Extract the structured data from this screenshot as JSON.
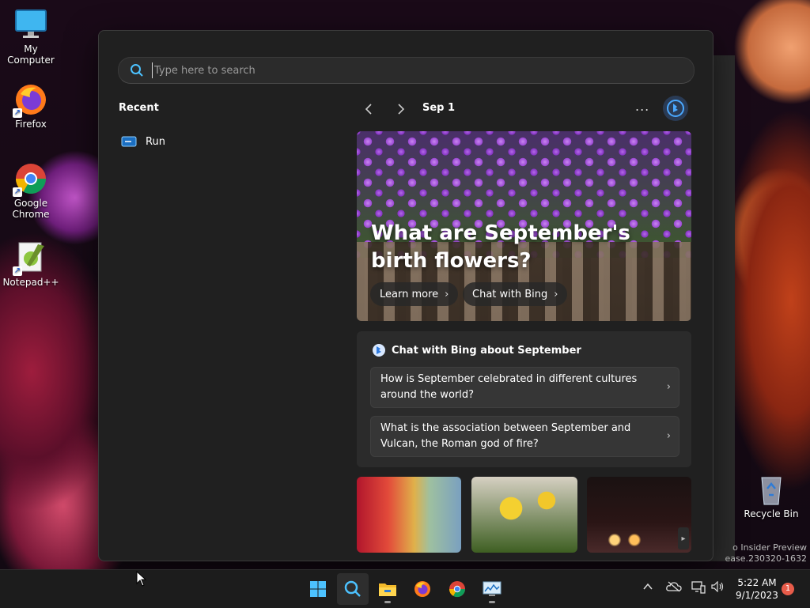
{
  "desktop": {
    "icons": [
      {
        "label": "My Computer"
      },
      {
        "label": "Firefox"
      },
      {
        "label": "Google Chrome"
      },
      {
        "label": "Notepad++"
      },
      {
        "label": "Recycle Bin"
      }
    ],
    "watermark": {
      "line1": "o Insider Preview",
      "line2": "ease.230320-1632"
    }
  },
  "search": {
    "placeholder": "Type here to search"
  },
  "recent": {
    "title": "Recent",
    "items": [
      {
        "label": "Run",
        "icon": "run-icon"
      }
    ]
  },
  "feed": {
    "date": "Sep 1",
    "more": "...",
    "hero": {
      "title": "What are September's birth flowers?",
      "learn_more": "Learn more",
      "chat_with_bing": "Chat with Bing"
    },
    "chat": {
      "heading": "Chat with Bing about September",
      "questions": [
        "How is September celebrated in different cultures around the world?",
        "What is the association between September and Vulcan, the Roman god of fire?"
      ]
    }
  },
  "taskbar": {
    "time": "5:22 AM",
    "date": "9/1/2023",
    "notifications": "1"
  },
  "colors": {
    "flyout_bg": "#202020",
    "card_bg": "#2b2b2b",
    "taskbar_bg": "#1c1c1c",
    "accent": "#0078d4"
  }
}
